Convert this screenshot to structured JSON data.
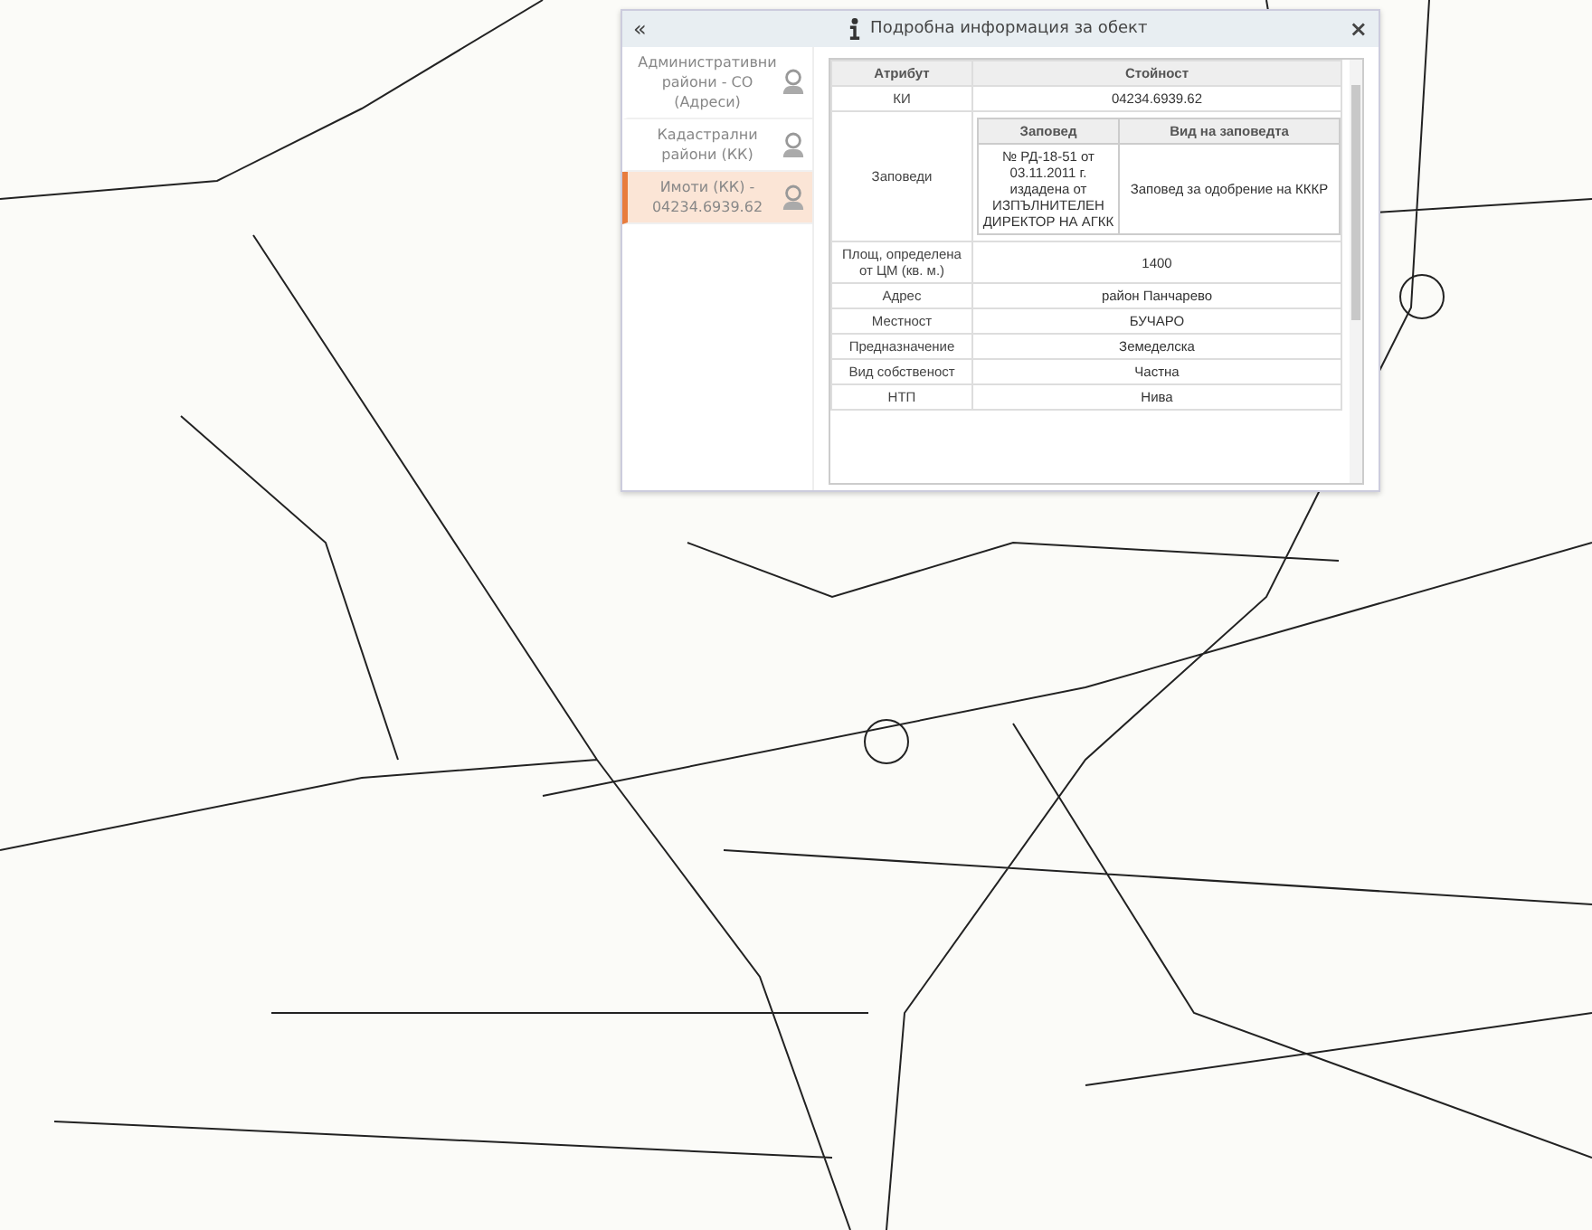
{
  "panel": {
    "collapse": "«",
    "title": "Подробна информация за обект",
    "close": "×",
    "layers": [
      {
        "label": "Административни райони - СО (Адреси)",
        "selected": false
      },
      {
        "label": "Кадастрални райони (КК)",
        "selected": false
      },
      {
        "label": "Имоти (КК) - 04234.6939.62",
        "selected": true
      }
    ],
    "table": {
      "columns": [
        "Атрибут",
        "Стойност"
      ],
      "rows": [
        {
          "kind": "text",
          "attribute": "КИ",
          "value": "04234.6939.62"
        },
        {
          "kind": "orders",
          "attribute": "Заповеди",
          "columns": [
            "Заповед",
            "Вид на заповедта"
          ],
          "rows": [
            [
              "№ РД-18-51 от 03.11.2011 г. издадена от ИЗПЪЛНИТЕЛЕН ДИРЕКТОР НА АГКК",
              "Заповед за одобрение на КККР"
            ]
          ]
        },
        {
          "kind": "text",
          "attribute": "Площ, определена от ЦМ (кв. м.)",
          "value": "1400"
        },
        {
          "kind": "text",
          "attribute": "Адрес",
          "value": "район Панчарево"
        },
        {
          "kind": "text",
          "attribute": "Местност",
          "value": "БУЧАРО"
        },
        {
          "kind": "text",
          "attribute": "Предназначение",
          "value": "Земеделска"
        },
        {
          "kind": "text",
          "attribute": "Вид собственост",
          "value": "Частна"
        },
        {
          "kind": "text",
          "attribute": "НТП",
          "value": "Нива"
        }
      ]
    }
  }
}
